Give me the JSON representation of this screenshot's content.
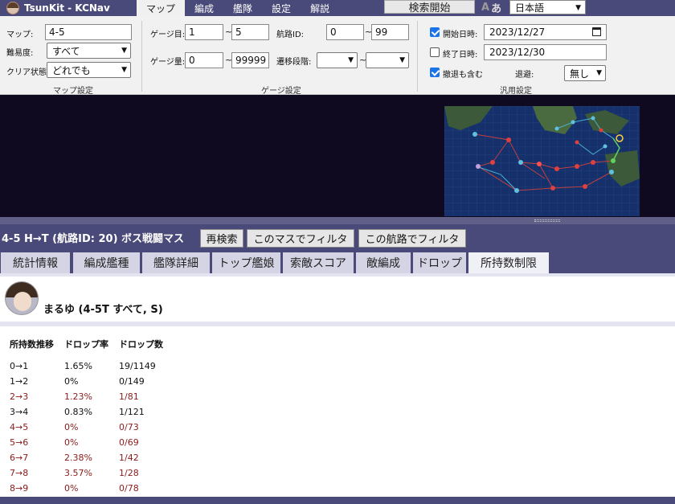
{
  "app": {
    "title": "TsunKit - KCNav"
  },
  "menu": {
    "tabs": [
      {
        "label": "マップ",
        "active": true
      },
      {
        "label": "編成"
      },
      {
        "label": "艦隊"
      },
      {
        "label": "設定"
      },
      {
        "label": "解説"
      }
    ],
    "search_button": "検索開始",
    "font_toggle": {
      "latin": "A",
      "kana": "あ"
    },
    "language": "日本語"
  },
  "settings": {
    "map": {
      "map_label": "マップ:",
      "map_value": "4-5",
      "difficulty_label": "難易度:",
      "difficulty_value": "すべて",
      "clear_label": "クリア状態:",
      "clear_value": "どれでも",
      "title": "マップ設定"
    },
    "gauge": {
      "gauge_num_label": "ゲージ目:",
      "gauge_num_from": "1",
      "gauge_num_to": "5",
      "route_id_label": "航路ID:",
      "route_id_from": "0",
      "route_id_to": "99",
      "gauge_amount_label": "ゲージ量:",
      "gauge_amount_from": "0",
      "gauge_amount_to": "99999",
      "transition_label": "遷移段階:",
      "transition_from": "",
      "transition_to": "",
      "tilde": "~",
      "title": "ゲージ設定"
    },
    "general": {
      "start_date_label": "開始日時:",
      "start_date_value": "2023/12/27",
      "start_checked": true,
      "end_date_label": "終了日時:",
      "end_date_value": "2023/12/30",
      "end_checked": false,
      "retreat_label": "撤退も含む",
      "retreat_checked": true,
      "evasion_label": "退避:",
      "evasion_value": "無し",
      "title": "汎用設定"
    }
  },
  "result": {
    "title": "4-5 H→T (航路ID: 20) ボス戦闘マス",
    "buttons": {
      "research": "再検索",
      "filter_node": "このマスでフィルタ",
      "filter_route": "この航路でフィルタ"
    }
  },
  "tabs": [
    {
      "label": "統計情報"
    },
    {
      "label": "編成艦種"
    },
    {
      "label": "艦隊詳細"
    },
    {
      "label": "トップ艦娘"
    },
    {
      "label": "索敵スコア"
    },
    {
      "label": "敵編成"
    },
    {
      "label": "ドロップ"
    },
    {
      "label": "所持数制限",
      "active": true
    }
  ],
  "ship": {
    "name": "まるゆ (4-5T すべて, S)"
  },
  "drop_table": {
    "headers": [
      "所持数推移",
      "ドロップ率",
      "ドロップ数"
    ],
    "rows": [
      [
        "0→1",
        "1.65%",
        "19/1149"
      ],
      [
        "1→2",
        "0%",
        "0/149"
      ],
      [
        "2→3",
        "1.23%",
        "1/81"
      ],
      [
        "3→4",
        "0.83%",
        "1/121"
      ],
      [
        "4→5",
        "0%",
        "0/73"
      ],
      [
        "5→6",
        "0%",
        "0/69"
      ],
      [
        "6→7",
        "2.38%",
        "1/42"
      ],
      [
        "7→8",
        "3.57%",
        "1/28"
      ],
      [
        "8→9",
        "0%",
        "0/78"
      ]
    ]
  },
  "colors": {
    "header_bg": "#4a4a7a",
    "map_bg": "#0f0a20",
    "alt_row_text": "#8b1a1a",
    "checkbox": "#1a73e8"
  }
}
